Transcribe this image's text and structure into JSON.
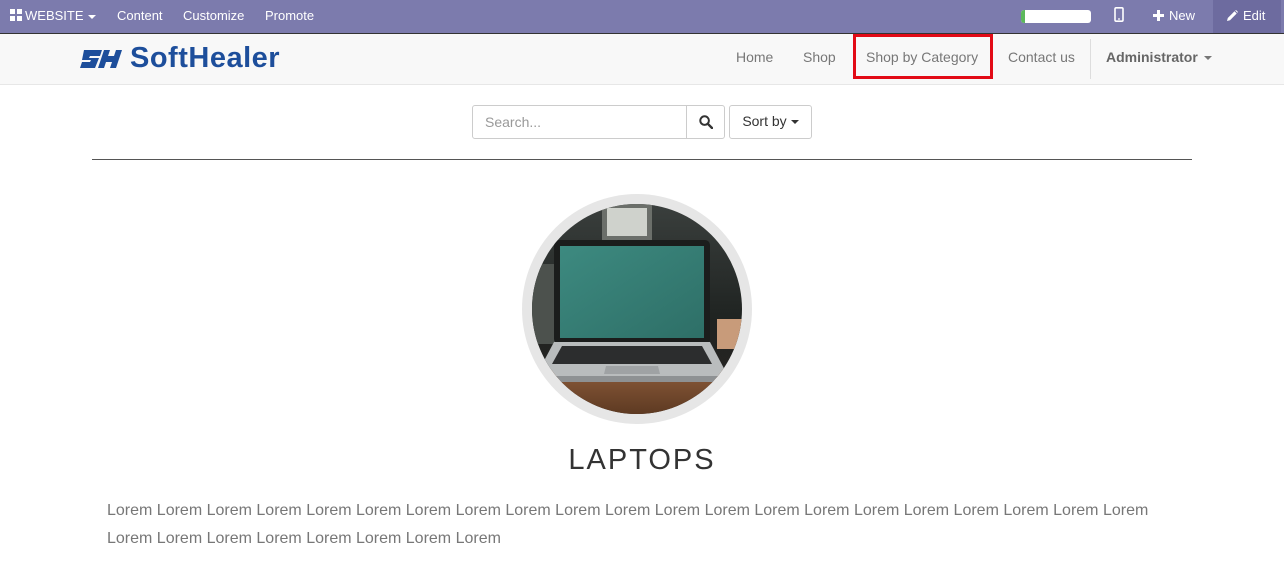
{
  "adminbar": {
    "website_label": "WEBSITE",
    "content_label": "Content",
    "customize_label": "Customize",
    "promote_label": "Promote",
    "progress": 0.06,
    "new_label": "New",
    "edit_label": "Edit",
    "bg_color": "#7c7bad"
  },
  "navbar": {
    "logo_text": "SoftHealer",
    "home": "Home",
    "shop": "Shop",
    "shop_by_category": "Shop by Category",
    "contact_us": "Contact us",
    "user": "Administrator",
    "highlight_color": "#e20a16"
  },
  "search": {
    "placeholder": "Search...",
    "sort_label": "Sort by"
  },
  "category": {
    "title": "LAPTOPS",
    "description": "Lorem Lorem Lorem Lorem Lorem Lorem Lorem Lorem Lorem Lorem Lorem Lorem Lorem Lorem Lorem Lorem Lorem Lorem Lorem Lorem Lorem Lorem Lorem Lorem Lorem Lorem Lorem Lorem Lorem"
  },
  "icons": {
    "apps": "apps-grid-icon",
    "mobile": "mobile-phone-icon",
    "plus": "plus-icon",
    "pencil": "pencil-icon",
    "search": "search-icon"
  }
}
